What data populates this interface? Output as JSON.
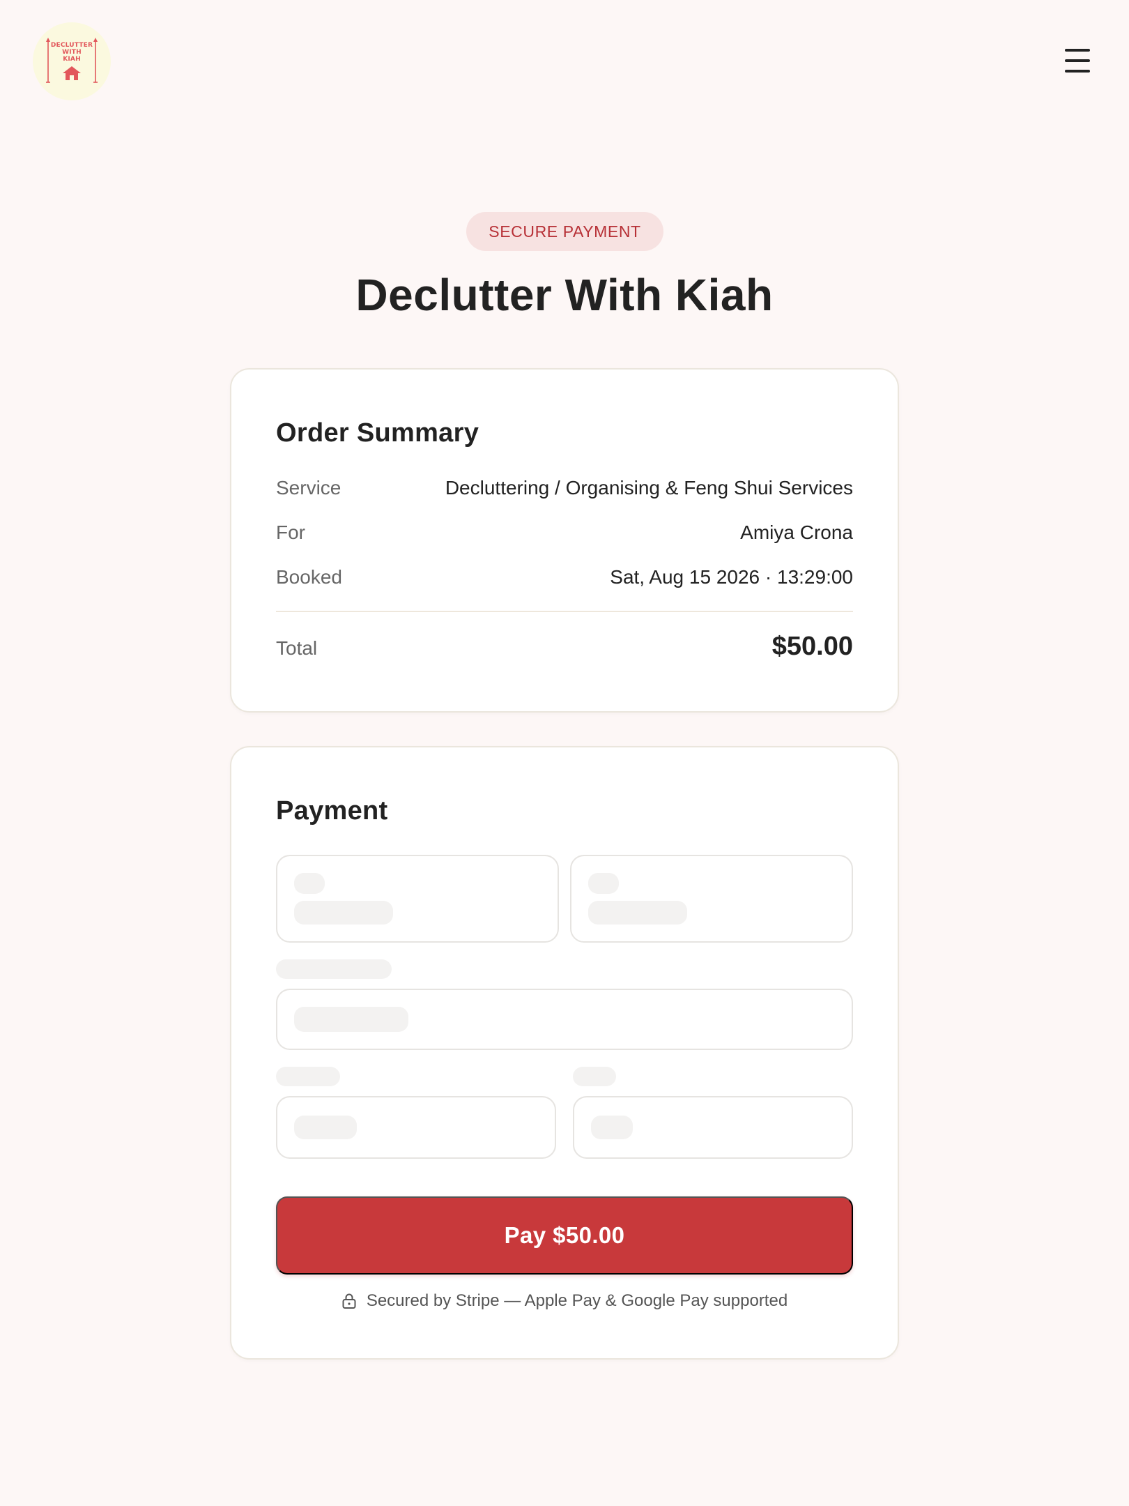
{
  "header": {
    "logo": {
      "line1": "DECLUTTER",
      "line2": "WITH",
      "line3": "KIAH",
      "icon": "house-icon"
    },
    "menu_icon": "hamburger-menu-icon"
  },
  "badge": "SECURE PAYMENT",
  "title": "Declutter With Kiah",
  "order_summary": {
    "heading": "Order Summary",
    "rows": [
      {
        "label": "Service",
        "value": "Decluttering / Organising & Feng Shui Services"
      },
      {
        "label": "For",
        "value": "Amiya Crona"
      },
      {
        "label": "Booked",
        "value": "Sat, Aug 15 2026 · 13:29:00"
      }
    ],
    "total_label": "Total",
    "total_value": "$50.00"
  },
  "payment": {
    "heading": "Payment",
    "pay_button": "Pay $50.00",
    "secure_note": "Secured by Stripe — Apple Pay & Google Pay supported",
    "secure_icon": "lock-icon"
  },
  "colors": {
    "background": "#fdf7f6",
    "accent": "#c8393b",
    "badge_bg": "#f7e2e1",
    "badge_text": "#b73036",
    "logo_bg": "#fbf9df",
    "logo_accent": "#e2575b"
  }
}
